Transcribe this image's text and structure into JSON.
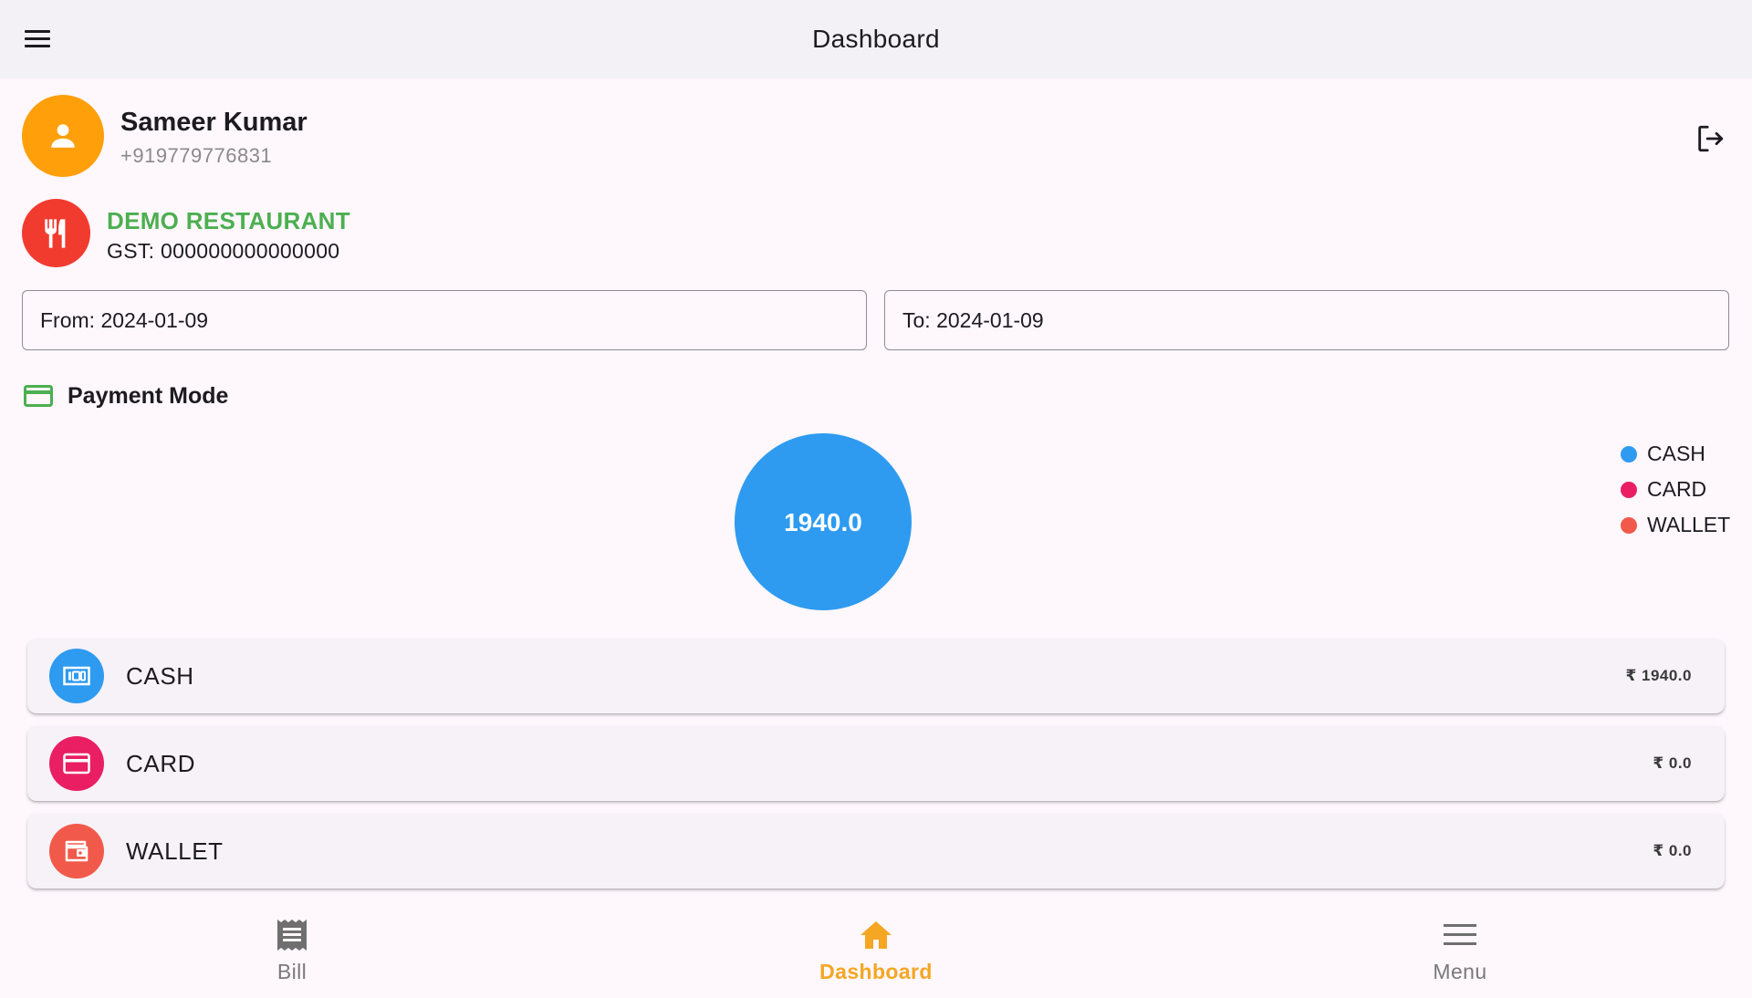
{
  "appbar": {
    "title": "Dashboard"
  },
  "user": {
    "name": "Sameer Kumar",
    "phone": "+919779776831"
  },
  "restaurant": {
    "name": "DEMO RESTAURANT",
    "gst": "GST: 000000000000000"
  },
  "dates": {
    "from": "From: 2024-01-09",
    "to": "To: 2024-01-09"
  },
  "section": {
    "title": "Payment Mode"
  },
  "colors": {
    "cash": "#2e9bf0",
    "card": "#e91e63",
    "wallet": "#f15a4a",
    "accent": "#f5a623",
    "restaurant_name": "#4caf50",
    "avatar": "#ff9f0a"
  },
  "chart_data": {
    "type": "pie",
    "categories": [
      "CASH",
      "CARD",
      "WALLET"
    ],
    "values": [
      1940.0,
      0.0,
      0.0
    ],
    "data_labels": [
      "1940.0"
    ],
    "legend_position": "top-right"
  },
  "payments": [
    {
      "label": "CASH",
      "amount": "₹ 1940.0",
      "icon": "cash-icon"
    },
    {
      "label": "CARD",
      "amount": "₹ 0.0",
      "icon": "credit-card-icon"
    },
    {
      "label": "WALLET",
      "amount": "₹ 0.0",
      "icon": "wallet-icon"
    }
  ],
  "nav": [
    {
      "label": "Bill",
      "icon": "receipt-icon"
    },
    {
      "label": "Dashboard",
      "icon": "home-icon",
      "active": true
    },
    {
      "label": "Menu",
      "icon": "menu-lines-icon"
    }
  ]
}
